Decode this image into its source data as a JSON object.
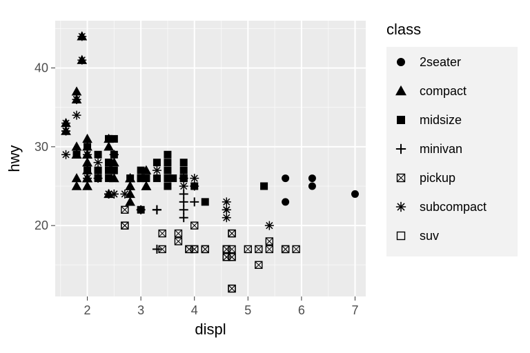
{
  "chart_data": {
    "type": "scatter",
    "xlabel": "displ",
    "ylabel": "hwy",
    "xlim": [
      1.4,
      7.2
    ],
    "ylim": [
      11,
      46
    ],
    "x_ticks": [
      2,
      3,
      4,
      5,
      6,
      7
    ],
    "y_ticks": [
      20,
      30,
      40
    ],
    "legend_title": "class",
    "series": [
      {
        "name": "2seater",
        "shape": "circle",
        "points": [
          [
            5.7,
            26
          ],
          [
            5.7,
            23
          ],
          [
            6.2,
            26
          ],
          [
            6.2,
            25
          ],
          [
            7.0,
            24
          ]
        ]
      },
      {
        "name": "compact",
        "shape": "triangle",
        "points": [
          [
            1.8,
            29
          ],
          [
            1.8,
            29
          ],
          [
            2.0,
            31
          ],
          [
            2.0,
            30
          ],
          [
            2.8,
            26
          ],
          [
            2.8,
            26
          ],
          [
            3.1,
            27
          ],
          [
            1.8,
            26
          ],
          [
            1.8,
            25
          ],
          [
            2.0,
            28
          ],
          [
            2.0,
            27
          ],
          [
            2.8,
            25
          ],
          [
            2.8,
            25
          ],
          [
            3.1,
            25
          ],
          [
            3.1,
            25
          ],
          [
            2.4,
            24
          ],
          [
            2.0,
            26
          ],
          [
            2.0,
            29
          ],
          [
            2.0,
            27
          ],
          [
            1.6,
            33
          ],
          [
            1.6,
            32
          ],
          [
            2.0,
            26
          ],
          [
            2.0,
            25
          ],
          [
            1.9,
            44
          ],
          [
            2.0,
            29
          ],
          [
            1.8,
            29
          ],
          [
            1.8,
            29
          ],
          [
            1.8,
            30
          ],
          [
            1.8,
            30
          ],
          [
            2.0,
            26
          ],
          [
            2.0,
            26
          ],
          [
            2.4,
            31
          ],
          [
            2.4,
            30
          ],
          [
            2.5,
            26
          ],
          [
            1.8,
            36
          ],
          [
            1.8,
            37
          ],
          [
            2.0,
            29
          ],
          [
            2.0,
            28
          ],
          [
            2.8,
            24
          ],
          [
            2.0,
            29
          ],
          [
            2.8,
            23
          ],
          [
            1.9,
            44
          ],
          [
            2.0,
            26
          ],
          [
            2.8,
            26
          ],
          [
            1.9,
            41
          ],
          [
            2.0,
            29
          ],
          [
            2.5,
            28
          ]
        ]
      },
      {
        "name": "midsize",
        "shape": "square",
        "points": [
          [
            2.8,
            26
          ],
          [
            3.1,
            26
          ],
          [
            4.2,
            23
          ],
          [
            2.4,
            27
          ],
          [
            2.5,
            27
          ],
          [
            2.5,
            29
          ],
          [
            3.0,
            26
          ],
          [
            3.5,
            26
          ],
          [
            3.6,
            26
          ],
          [
            2.4,
            26
          ],
          [
            3.5,
            28
          ],
          [
            3.5,
            29
          ],
          [
            2.4,
            27
          ],
          [
            3.0,
            22
          ],
          [
            3.3,
            26
          ],
          [
            3.5,
            25
          ],
          [
            3.8,
            26
          ],
          [
            3.8,
            27
          ],
          [
            3.8,
            26
          ],
          [
            3.8,
            28
          ],
          [
            4.0,
            25
          ],
          [
            2.2,
            27
          ],
          [
            2.2,
            29
          ],
          [
            2.4,
            31
          ],
          [
            2.4,
            31
          ],
          [
            3.0,
            26
          ],
          [
            3.0,
            26
          ],
          [
            3.5,
            27
          ],
          [
            2.2,
            26
          ],
          [
            2.2,
            27
          ],
          [
            2.4,
            28
          ],
          [
            2.4,
            28
          ],
          [
            3.0,
            26
          ],
          [
            3.0,
            27
          ],
          [
            3.3,
            28
          ],
          [
            1.8,
            29
          ],
          [
            2.0,
            27
          ],
          [
            2.0,
            30
          ],
          [
            3.8,
            26
          ],
          [
            5.3,
            25
          ],
          [
            2.5,
            31
          ]
        ]
      },
      {
        "name": "minivan",
        "shape": "plus",
        "points": [
          [
            2.4,
            24
          ],
          [
            3.0,
            22
          ],
          [
            3.3,
            22
          ],
          [
            3.3,
            22
          ],
          [
            3.3,
            17
          ],
          [
            3.3,
            22
          ],
          [
            3.8,
            24
          ],
          [
            3.8,
            22
          ],
          [
            3.8,
            21
          ],
          [
            3.8,
            23
          ],
          [
            4.0,
            23
          ]
        ]
      },
      {
        "name": "pickup",
        "shape": "box_x",
        "points": [
          [
            3.7,
            19
          ],
          [
            3.7,
            18
          ],
          [
            3.9,
            17
          ],
          [
            3.9,
            17
          ],
          [
            4.7,
            19
          ],
          [
            4.7,
            19
          ],
          [
            4.7,
            12
          ],
          [
            5.2,
            17
          ],
          [
            5.2,
            15
          ],
          [
            5.9,
            17
          ],
          [
            4.7,
            16
          ],
          [
            4.7,
            12
          ],
          [
            2.7,
            20
          ],
          [
            2.7,
            20
          ],
          [
            2.7,
            22
          ],
          [
            3.4,
            17
          ],
          [
            3.4,
            19
          ],
          [
            4.0,
            20
          ],
          [
            4.0,
            17
          ],
          [
            4.6,
            17
          ],
          [
            5.0,
            17
          ],
          [
            4.2,
            17
          ],
          [
            4.2,
            17
          ],
          [
            4.6,
            16
          ],
          [
            4.6,
            16
          ],
          [
            4.6,
            17
          ],
          [
            5.4,
            17
          ],
          [
            5.4,
            18
          ],
          [
            4.0,
            17
          ],
          [
            4.7,
            17
          ],
          [
            4.7,
            16
          ],
          [
            5.7,
            17
          ],
          [
            5.7,
            17
          ]
        ]
      },
      {
        "name": "subcompact",
        "shape": "asterisk",
        "points": [
          [
            3.8,
            26
          ],
          [
            3.8,
            25
          ],
          [
            4.0,
            26
          ],
          [
            4.0,
            25
          ],
          [
            4.6,
            21
          ],
          [
            4.6,
            22
          ],
          [
            4.6,
            23
          ],
          [
            4.6,
            22
          ],
          [
            5.4,
            20
          ],
          [
            1.6,
            33
          ],
          [
            1.6,
            32
          ],
          [
            1.6,
            32
          ],
          [
            1.6,
            29
          ],
          [
            1.6,
            32
          ],
          [
            1.8,
            34
          ],
          [
            1.8,
            36
          ],
          [
            1.8,
            36
          ],
          [
            2.0,
            29
          ],
          [
            2.4,
            24
          ],
          [
            2.4,
            24
          ],
          [
            2.5,
            24
          ],
          [
            2.5,
            24
          ],
          [
            3.3,
            27
          ],
          [
            2.0,
            26
          ],
          [
            2.0,
            26
          ],
          [
            2.2,
            26
          ],
          [
            2.2,
            28
          ],
          [
            2.5,
            29
          ],
          [
            2.5,
            29
          ],
          [
            2.5,
            29
          ],
          [
            2.5,
            29
          ],
          [
            2.7,
            24
          ],
          [
            1.9,
            44
          ],
          [
            1.9,
            41
          ],
          [
            2.0,
            29
          ]
        ]
      },
      {
        "name": "suv",
        "shape": "square_open",
        "points": []
      }
    ]
  }
}
